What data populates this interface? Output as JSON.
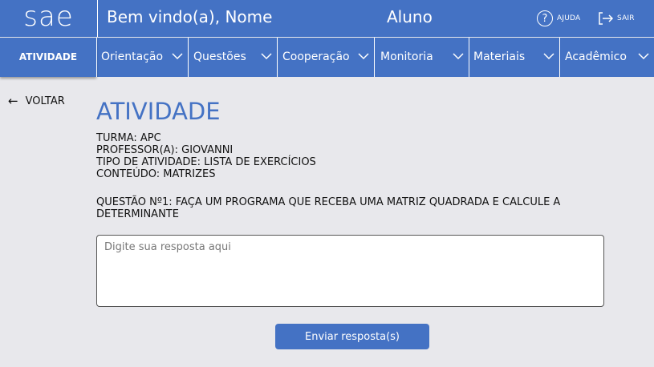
{
  "header": {
    "logo": "sae",
    "welcome": "Bem vindo(a), Nome",
    "role": "Aluno",
    "help_label": "AJUDA",
    "logout_label": "SAIR",
    "help_icon": "help-circle-icon",
    "logout_icon": "logout-icon"
  },
  "nav": {
    "active": "ATIVIDADE",
    "items": [
      {
        "label": "Orientação"
      },
      {
        "label": "Questões"
      },
      {
        "label": "Cooperação"
      },
      {
        "label": "Monitoria"
      },
      {
        "label": "Materiais"
      },
      {
        "label": "Acadêmico"
      }
    ]
  },
  "back_label": "VOLTAR",
  "activity": {
    "title": "ATIVIDADE",
    "turma": "TURMA: APC",
    "professor": "PROFESSOR(A): GIOVANNI",
    "tipo": "TIPO DE ATIVIDADE: LISTA DE EXERCÍCIOS",
    "conteudo": "CONTEÚDO: MATRIZES",
    "question": "QUESTÃO Nº1: FAÇA UM PROGRAMA QUE RECEBA UMA MATRIZ QUADRADA E CALCULE A DETERMINANTE"
  },
  "answer": {
    "placeholder": "Digite sua resposta aqui",
    "value": ""
  },
  "submit_label": "Enviar resposta(s)",
  "colors": {
    "primary": "#4472c4",
    "background": "#e8e8ec"
  }
}
